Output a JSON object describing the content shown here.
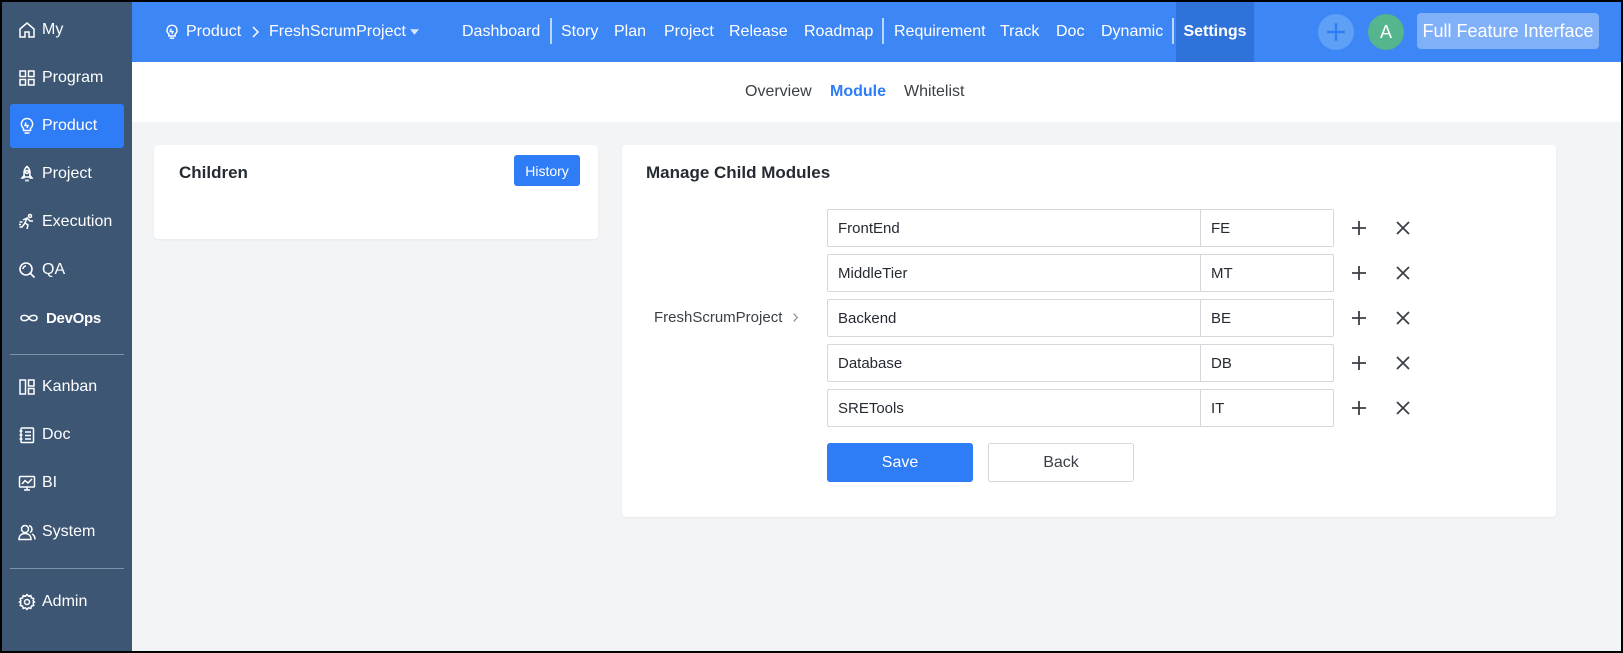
{
  "sidebar": {
    "items": [
      {
        "label": "My",
        "icon": "home-icon"
      },
      {
        "label": "Program",
        "icon": "grid-icon"
      },
      {
        "label": "Product",
        "icon": "lightbulb-icon"
      },
      {
        "label": "Project",
        "icon": "rocket-icon"
      },
      {
        "label": "Execution",
        "icon": "runner-icon"
      },
      {
        "label": "QA",
        "icon": "search-icon"
      },
      {
        "label": "DevOps",
        "icon": "infinity-icon"
      },
      {
        "label": "Kanban",
        "icon": "kanban-icon"
      },
      {
        "label": "Doc",
        "icon": "document-icon"
      },
      {
        "label": "BI",
        "icon": "monitor-chart-icon"
      },
      {
        "label": "System",
        "icon": "users-icon"
      },
      {
        "label": "Admin",
        "icon": "gear-icon"
      }
    ],
    "active": "Product"
  },
  "topbar": {
    "breadcrumb": {
      "root": "Product",
      "current": "FreshScrumProject"
    },
    "nav": [
      "Dashboard",
      "Story",
      "Plan",
      "Project",
      "Release",
      "Roadmap",
      "Requirement",
      "Track",
      "Doc",
      "Dynamic",
      "Settings"
    ],
    "active_nav": "Settings",
    "avatar_letter": "A",
    "full_feature_label": "Full Feature Interface"
  },
  "subnav": {
    "tabs": [
      "Overview",
      "Module",
      "Whitelist"
    ],
    "active": "Module"
  },
  "children_panel": {
    "title": "Children",
    "history_label": "History"
  },
  "manage_panel": {
    "title": "Manage Child Modules",
    "parent": "FreshScrumProject",
    "modules": [
      {
        "name": "FrontEnd",
        "short": "FE"
      },
      {
        "name": "MiddleTier",
        "short": "MT"
      },
      {
        "name": "Backend",
        "short": "BE"
      },
      {
        "name": "Database",
        "short": "DB"
      },
      {
        "name": "SRETools",
        "short": "IT"
      }
    ],
    "save_label": "Save",
    "back_label": "Back"
  },
  "colors": {
    "primary": "#2e7cf6",
    "topbar": "#3d86f5",
    "sidebar": "#3c5674"
  }
}
